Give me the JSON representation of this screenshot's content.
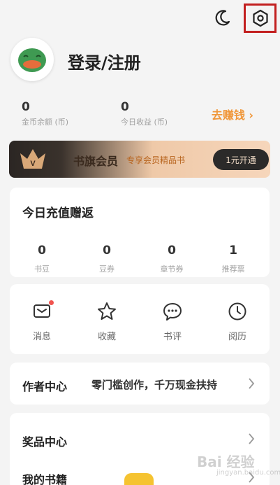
{
  "profile": {
    "login_label": "登录/注册"
  },
  "balances": {
    "coins_value": "0",
    "coins_label": "金币余额 (币)",
    "today_value": "0",
    "today_label": "今日收益 (币)",
    "earn_label": "去赚钱 ›"
  },
  "vip": {
    "title": "书旗会员",
    "subtitle": "专享会员精品书",
    "button": "1元开通"
  },
  "recharge": {
    "title": "今日充值赠返",
    "stats": [
      {
        "value": "0",
        "label": "书豆"
      },
      {
        "value": "0",
        "label": "豆券"
      },
      {
        "value": "0",
        "label": "章节券"
      },
      {
        "value": "1",
        "label": "推荐票"
      }
    ]
  },
  "quick_actions": [
    {
      "label": "消息",
      "icon": "message-icon"
    },
    {
      "label": "收藏",
      "icon": "star-icon"
    },
    {
      "label": "书评",
      "icon": "comment-icon"
    },
    {
      "label": "阅历",
      "icon": "clock-icon"
    }
  ],
  "author": {
    "title": "作者中心",
    "desc": "零门槛创作，千万现金扶持"
  },
  "list": [
    {
      "label": "奖品中心"
    },
    {
      "label": "我的书籍"
    }
  ],
  "watermark": {
    "main": "Bai 经验",
    "sub": "jingyan.baidu.com"
  },
  "colors": {
    "accent": "#f0973a",
    "highlight_border": "#c21f1f",
    "notification_dot": "#f0544f",
    "vip_button_bg": "#2b2a29"
  }
}
